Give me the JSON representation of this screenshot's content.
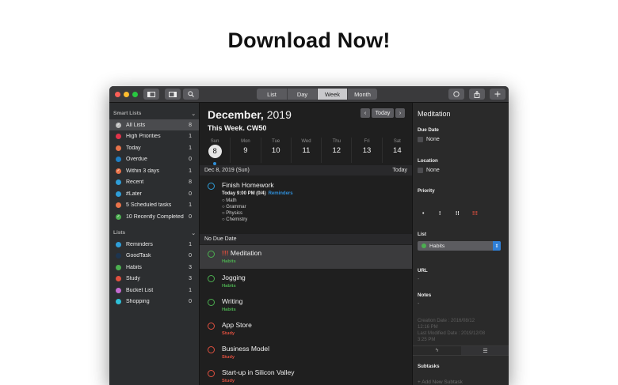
{
  "headline": "Download Now!",
  "toolbar": {
    "views": [
      "List",
      "Day",
      "Week",
      "Month"
    ],
    "active_view": "Week"
  },
  "colors": {
    "red": "#e0334a",
    "orange": "#e8734a",
    "blue": "#1f7fc4",
    "light_blue": "#2f9ed8",
    "green": "#4caf50",
    "purple": "#c46bd0",
    "cyan": "#2fc0d8",
    "gray": "#bdbdbd",
    "navy": "#1d3550"
  },
  "sidebar": {
    "smart_title": "Smart Lists",
    "smart_lists": [
      {
        "label": "All Lists",
        "count": "8",
        "icon": "check-circle-icon",
        "color": "#bdbdbd"
      },
      {
        "label": "High Priorities",
        "count": "1",
        "icon": "flag-icon",
        "color": "#e0334a"
      },
      {
        "label": "Today",
        "count": "1",
        "icon": "sun-icon",
        "color": "#e8734a"
      },
      {
        "label": "Overdue",
        "count": "0",
        "icon": "clock-icon",
        "color": "#1f7fc4"
      },
      {
        "label": "Within 3 days",
        "count": "1",
        "icon": "check-circle-icon",
        "color": "#e8734a"
      },
      {
        "label": "Recent",
        "count": "8",
        "icon": "clock-icon",
        "color": "#2f9ed8"
      },
      {
        "label": "#Later",
        "count": "0",
        "icon": "tag-icon",
        "color": "#2f9ed8"
      },
      {
        "label": "5 Scheduled tasks",
        "count": "1",
        "icon": "calendar-icon",
        "color": "#e8734a"
      },
      {
        "label": "10 Recently Completed",
        "count": "0",
        "icon": "check-circle-icon",
        "color": "#4caf50"
      }
    ],
    "lists_title": "Lists",
    "lists": [
      {
        "label": "Reminders",
        "count": "1",
        "color": "#2f9ed8"
      },
      {
        "label": "GoodTask",
        "count": "0",
        "color": "#1d3550"
      },
      {
        "label": "Habits",
        "count": "3",
        "color": "#4caf50"
      },
      {
        "label": "Study",
        "count": "3",
        "color": "#e0503f"
      },
      {
        "label": "Bucket List",
        "count": "1",
        "color": "#c46bd0"
      },
      {
        "label": "Shopping",
        "count": "0",
        "color": "#2fc0d8"
      }
    ]
  },
  "main": {
    "month": "December,",
    "year": "2019",
    "week": "This Week. CW50",
    "today_btn": "Today",
    "days": [
      {
        "name": "Sun",
        "num": "8",
        "today": true
      },
      {
        "name": "Mon",
        "num": "9"
      },
      {
        "name": "Tue",
        "num": "10"
      },
      {
        "name": "Wed",
        "num": "11"
      },
      {
        "name": "Thu",
        "num": "12"
      },
      {
        "name": "Fri",
        "num": "13"
      },
      {
        "name": "Sat",
        "num": "14"
      }
    ],
    "date_header": "Dec 8, 2019 (Sun)",
    "date_header_right": "Today",
    "dated_task": {
      "title": "Finish Homework",
      "time": "Today 9:00 PM (0/4)",
      "list": "Reminders",
      "subtasks": [
        "Math",
        "Grammar",
        "Physics",
        "Chemistry"
      ]
    },
    "no_due_header": "No Due Date",
    "tasks": [
      {
        "title": "Meditation",
        "priority": "!!!",
        "list": "Habits",
        "color": "#4caf50",
        "selected": true
      },
      {
        "title": "Jogging",
        "list": "Habits",
        "color": "#4caf50"
      },
      {
        "title": "Writing",
        "list": "Habits",
        "color": "#4caf50"
      },
      {
        "title": "App Store",
        "list": "Study",
        "color": "#e0503f"
      },
      {
        "title": "Business Model",
        "list": "Study",
        "color": "#e0503f"
      },
      {
        "title": "Start-up in Silicon Valley",
        "list": "Study",
        "color": "#e0503f"
      }
    ]
  },
  "inspector": {
    "title": "Meditation",
    "due_label": "Due Date",
    "due_value": "None",
    "location_label": "Location",
    "location_value": "None",
    "priority_label": "Priority",
    "priorities": [
      "•",
      "!",
      "!!",
      "!!!"
    ],
    "list_label": "List",
    "list_value": "Habits",
    "url_label": "URL",
    "url_value": "-",
    "notes_label": "Notes",
    "notes_value": "-",
    "creation": "Creation Date : 2016/08/12",
    "creation_time": "12:16 PM",
    "modified": "Last Modified Date : 2019/12/08",
    "modified_time": "3:25 PM",
    "subtasks_label": "Subtasks",
    "add_subtask": "Add New Subtask"
  }
}
